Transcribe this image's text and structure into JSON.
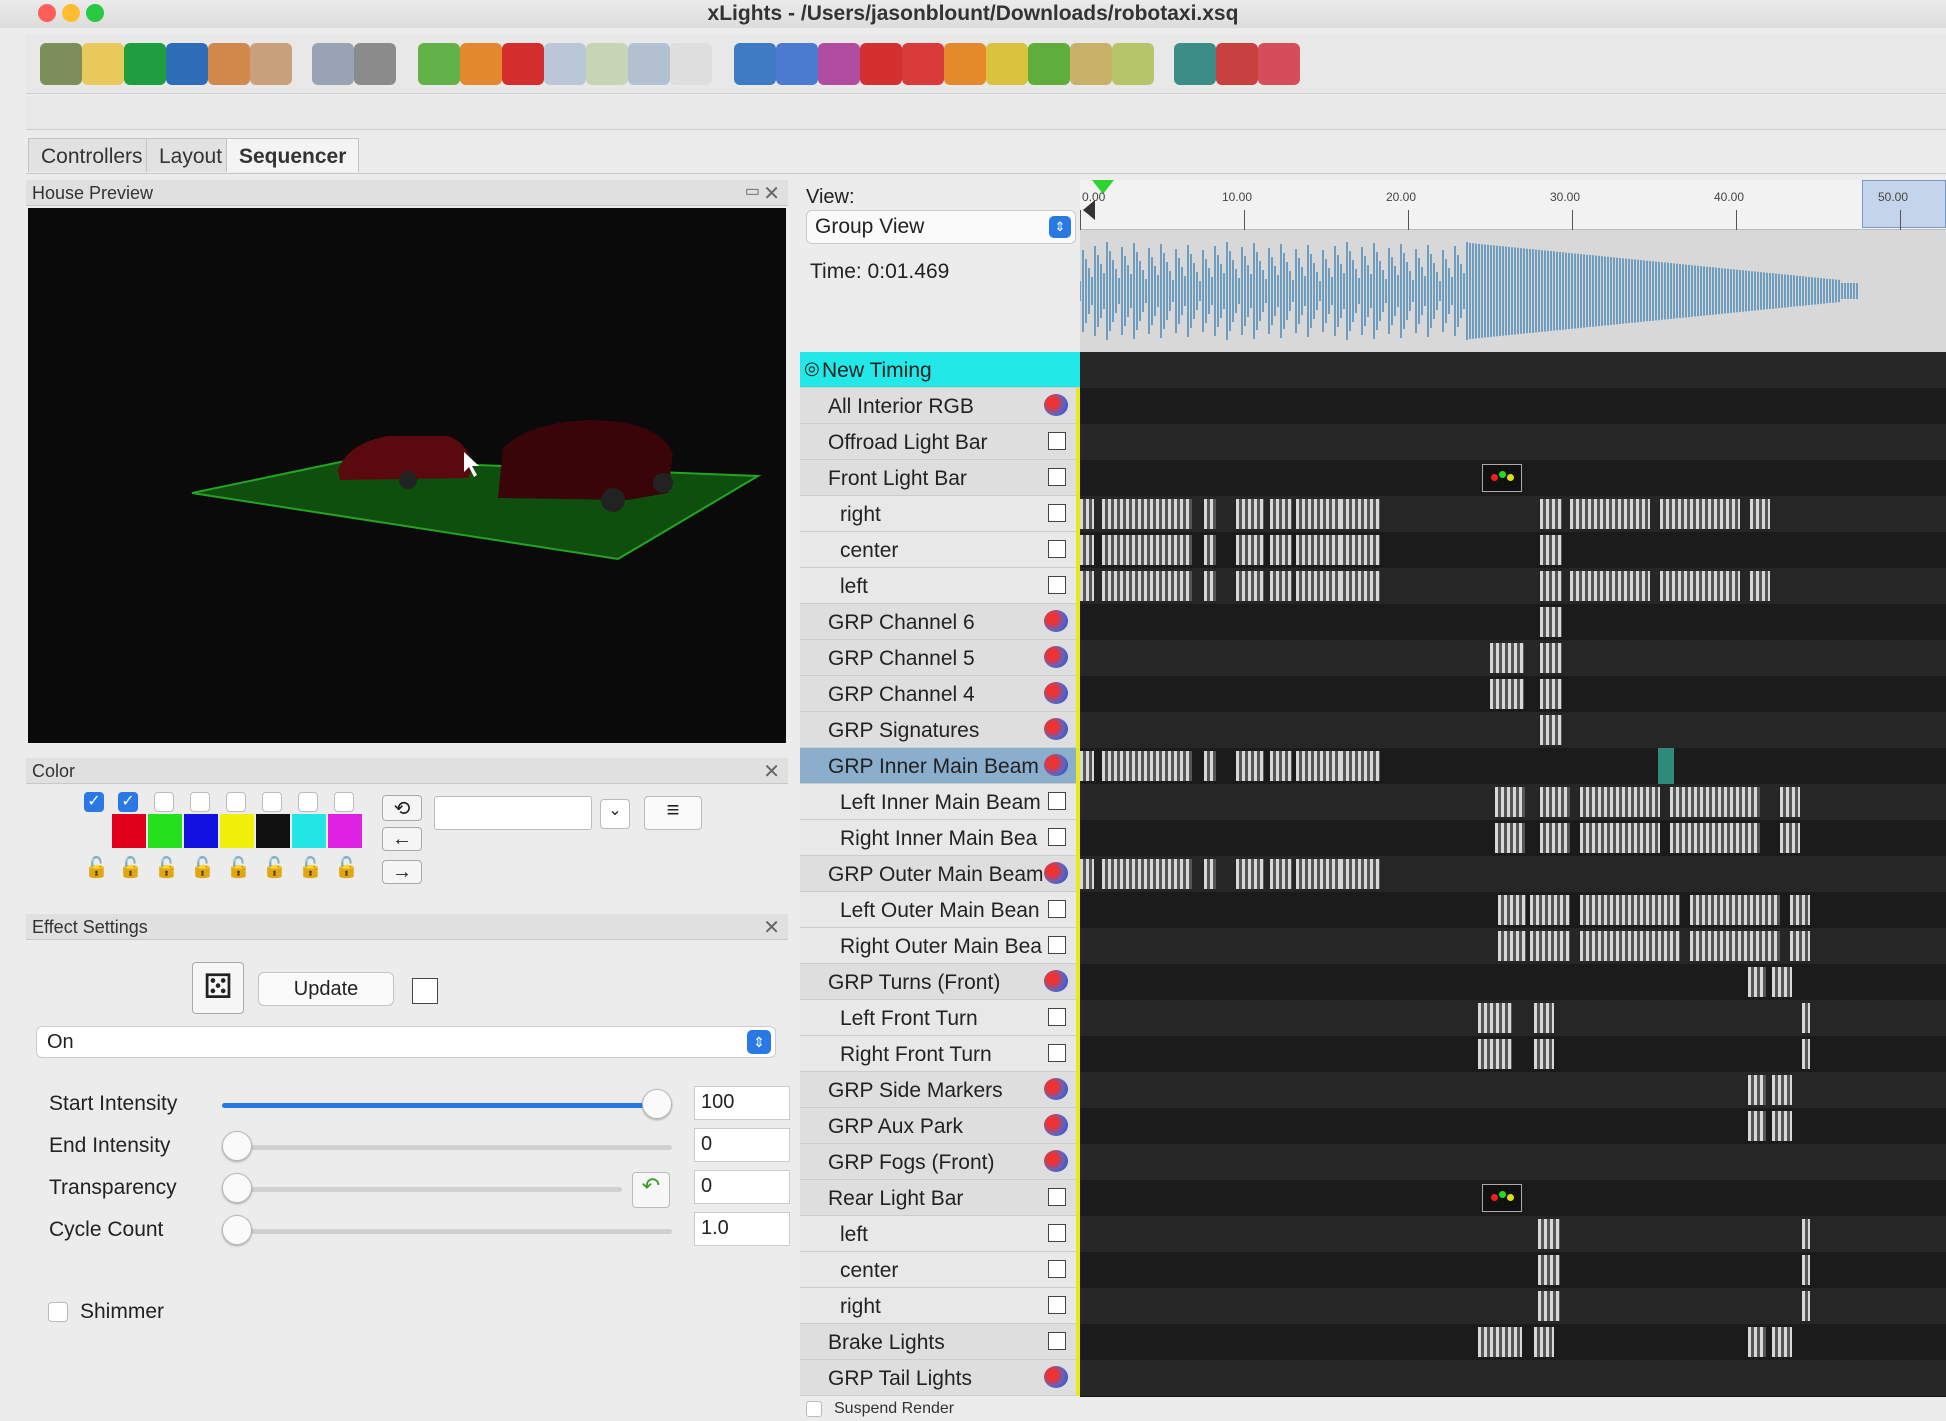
{
  "window": {
    "title": "xLights - /Users/jasonblount/Downloads/robotaxi.xsq"
  },
  "tabs": [
    "Controllers",
    "Layout",
    "Sequencer"
  ],
  "panels": {
    "preview": "House Preview",
    "color": "Color",
    "effect": "Effect Settings"
  },
  "sequencer": {
    "view_label": "View:",
    "view_value": "Group View",
    "time": "Time: 0:01.469",
    "suspend": "Suspend Render",
    "ticks": [
      "0.00",
      "10.00",
      "20.00",
      "30.00",
      "40.00",
      "50.00"
    ]
  },
  "rows": [
    {
      "label": "New Timing",
      "kind": "timing"
    },
    {
      "label": "All Interior RGB",
      "kind": "group"
    },
    {
      "label": "Offroad Light Bar",
      "kind": "model"
    },
    {
      "label": "Front Light Bar",
      "kind": "model"
    },
    {
      "label": "right",
      "kind": "sub"
    },
    {
      "label": "center",
      "kind": "sub"
    },
    {
      "label": "left",
      "kind": "sub"
    },
    {
      "label": "GRP Channel 6",
      "kind": "group"
    },
    {
      "label": "GRP Channel 5",
      "kind": "group"
    },
    {
      "label": "GRP Channel 4",
      "kind": "group"
    },
    {
      "label": "GRP Signatures",
      "kind": "group"
    },
    {
      "label": "GRP Inner Main Beam",
      "kind": "group",
      "selected": true
    },
    {
      "label": "Left Inner Main Beam",
      "kind": "sub"
    },
    {
      "label": "Right Inner Main Bea",
      "kind": "sub"
    },
    {
      "label": "GRP Outer Main Beam",
      "kind": "group"
    },
    {
      "label": "Left Outer Main Bean",
      "kind": "sub"
    },
    {
      "label": "Right Outer Main Bea",
      "kind": "sub"
    },
    {
      "label": "GRP Turns (Front)",
      "kind": "group"
    },
    {
      "label": "Left Front Turn",
      "kind": "sub"
    },
    {
      "label": "Right Front Turn",
      "kind": "sub"
    },
    {
      "label": "GRP Side Markers",
      "kind": "group"
    },
    {
      "label": "GRP Aux Park",
      "kind": "group"
    },
    {
      "label": "GRP Fogs (Front)",
      "kind": "group"
    },
    {
      "label": "Rear Light Bar",
      "kind": "model"
    },
    {
      "label": "left",
      "kind": "sub"
    },
    {
      "label": "center",
      "kind": "sub"
    },
    {
      "label": "right",
      "kind": "sub"
    },
    {
      "label": "Brake Lights",
      "kind": "model"
    },
    {
      "label": "GRP Tail Lights",
      "kind": "group"
    }
  ],
  "effect": {
    "type": "On",
    "update": "Update",
    "start_intensity_label": "Start Intensity",
    "start_intensity": "100",
    "start_intensity_level": 1.0,
    "end_intensity_label": "End Intensity",
    "end_intensity": "0",
    "end_intensity_level": 0,
    "transparency_label": "Transparency",
    "transparency": "0",
    "transparency_level": 0,
    "cycle_label": "Cycle Count",
    "cycle": "1.0",
    "cycle_level": 0,
    "shimmer_label": "Shimmer"
  },
  "colors": {
    "palette": [
      "#e0001b",
      "#25e01d",
      "#1212e0",
      "#f0f00a",
      "#111111",
      "#22e6e6",
      "#e020e0"
    ],
    "accent": "#2a78e4",
    "timing_row": "#22e8e8",
    "selected_row": "#8aaecc"
  }
}
